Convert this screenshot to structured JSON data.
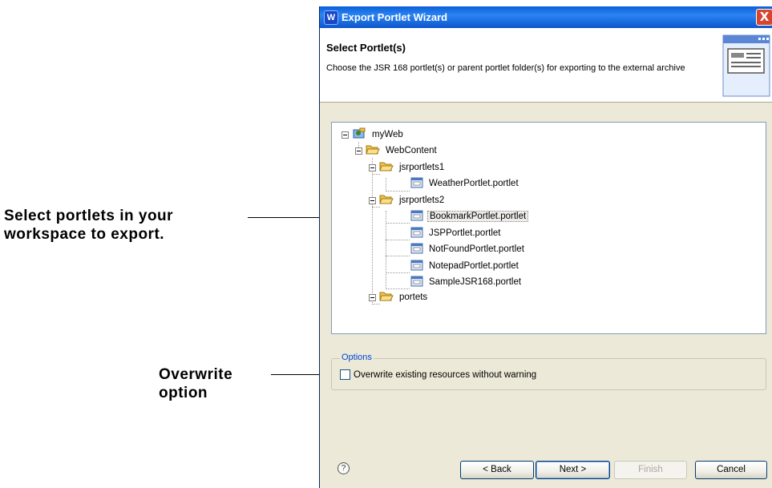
{
  "annotations": {
    "select_line1": "Select portlets in your",
    "select_line2": "workspace to export.",
    "overwrite_line1": "Overwrite",
    "overwrite_line2": "option"
  },
  "window": {
    "title": "Export Portlet Wizard",
    "close_glyph": "X",
    "app_icon": "W"
  },
  "header": {
    "title": "Select Portlet(s)",
    "description": "Choose the JSR 168 portlet(s) or parent portlet folder(s) for exporting to the external archive"
  },
  "tree": {
    "project": "myWeb",
    "webcontent": "WebContent",
    "folder1": "jsrportlets1",
    "folder1_items": [
      "WeatherPortlet.portlet"
    ],
    "folder2": "jsrportlets2",
    "folder2_items": [
      "BookmarkPortlet.portlet",
      "JSPPortlet.portlet",
      "NotFoundPortlet.portlet",
      "NotepadPortlet.portlet",
      "SampleJSR168.portlet"
    ],
    "folder3": "portets",
    "selected": "BookmarkPortlet.portlet"
  },
  "options": {
    "legend": "Options",
    "overwrite_label": "Overwrite existing resources without warning",
    "overwrite_checked": false
  },
  "buttons": {
    "help": "?",
    "back": "< Back",
    "next": "Next >",
    "finish": "Finish",
    "cancel": "Cancel"
  },
  "colors": {
    "title_bar": "#0a5fd8",
    "dialog_bg": "#ece9d8",
    "folder": "#f5c242",
    "options_legend": "#0046d5"
  }
}
